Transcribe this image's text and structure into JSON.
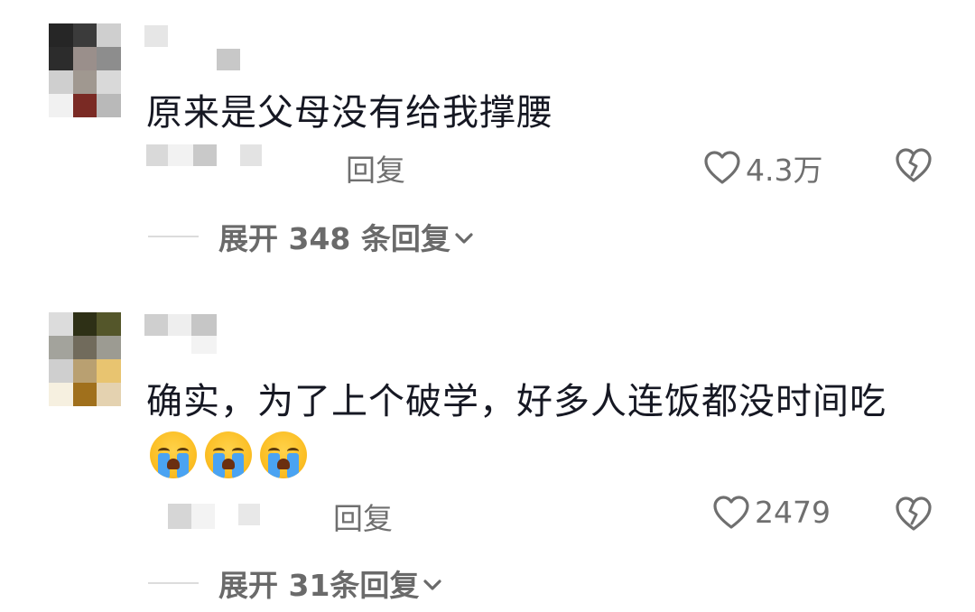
{
  "comments": [
    {
      "text": "原来是父母没有给我撑腰",
      "reply_label": "回复",
      "likes": "4.3万",
      "expand_label": "展开 348 条回复",
      "emojis": []
    },
    {
      "text": "确实，为了上个破学，好多人连饭都没时间吃",
      "reply_label": "回复",
      "likes": "2479",
      "expand_label": "展开 31条回复",
      "emojis": [
        "loudly-crying-face",
        "loudly-crying-face",
        "loudly-crying-face"
      ]
    }
  ],
  "colors": {
    "text": "#161823",
    "secondary": "#6f6f6f",
    "emoji_yellow": "#fbbd22",
    "tear_blue": "#4aa3f2"
  },
  "icons": {
    "like": "heart-outline-icon",
    "dislike": "broken-heart-icon",
    "expand": "chevron-down-icon"
  }
}
